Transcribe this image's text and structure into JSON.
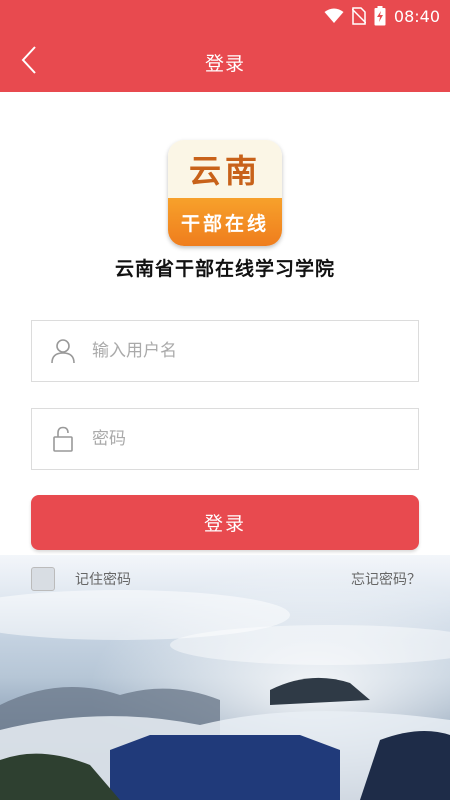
{
  "status_bar": {
    "time": "08:40",
    "icons": [
      "wifi-icon",
      "no-sim-icon",
      "battery-charging-icon"
    ]
  },
  "nav": {
    "title": "登录",
    "back_icon": "chevron-left-icon"
  },
  "logo": {
    "icon_top_text": "云南",
    "icon_bottom_text": "干部在线",
    "org_name": "云南省干部在线学习学院"
  },
  "form": {
    "username": {
      "value": "",
      "placeholder": "输入用户名",
      "icon": "user-icon"
    },
    "password": {
      "value": "",
      "placeholder": "密码",
      "icon": "lock-icon"
    },
    "login_label": "登录",
    "remember_label": "记住密码",
    "remember_checked": false,
    "forgot_label": "忘记密码？"
  },
  "colors": {
    "brand": "#e84a4f",
    "icon_orange": "#f39425"
  }
}
